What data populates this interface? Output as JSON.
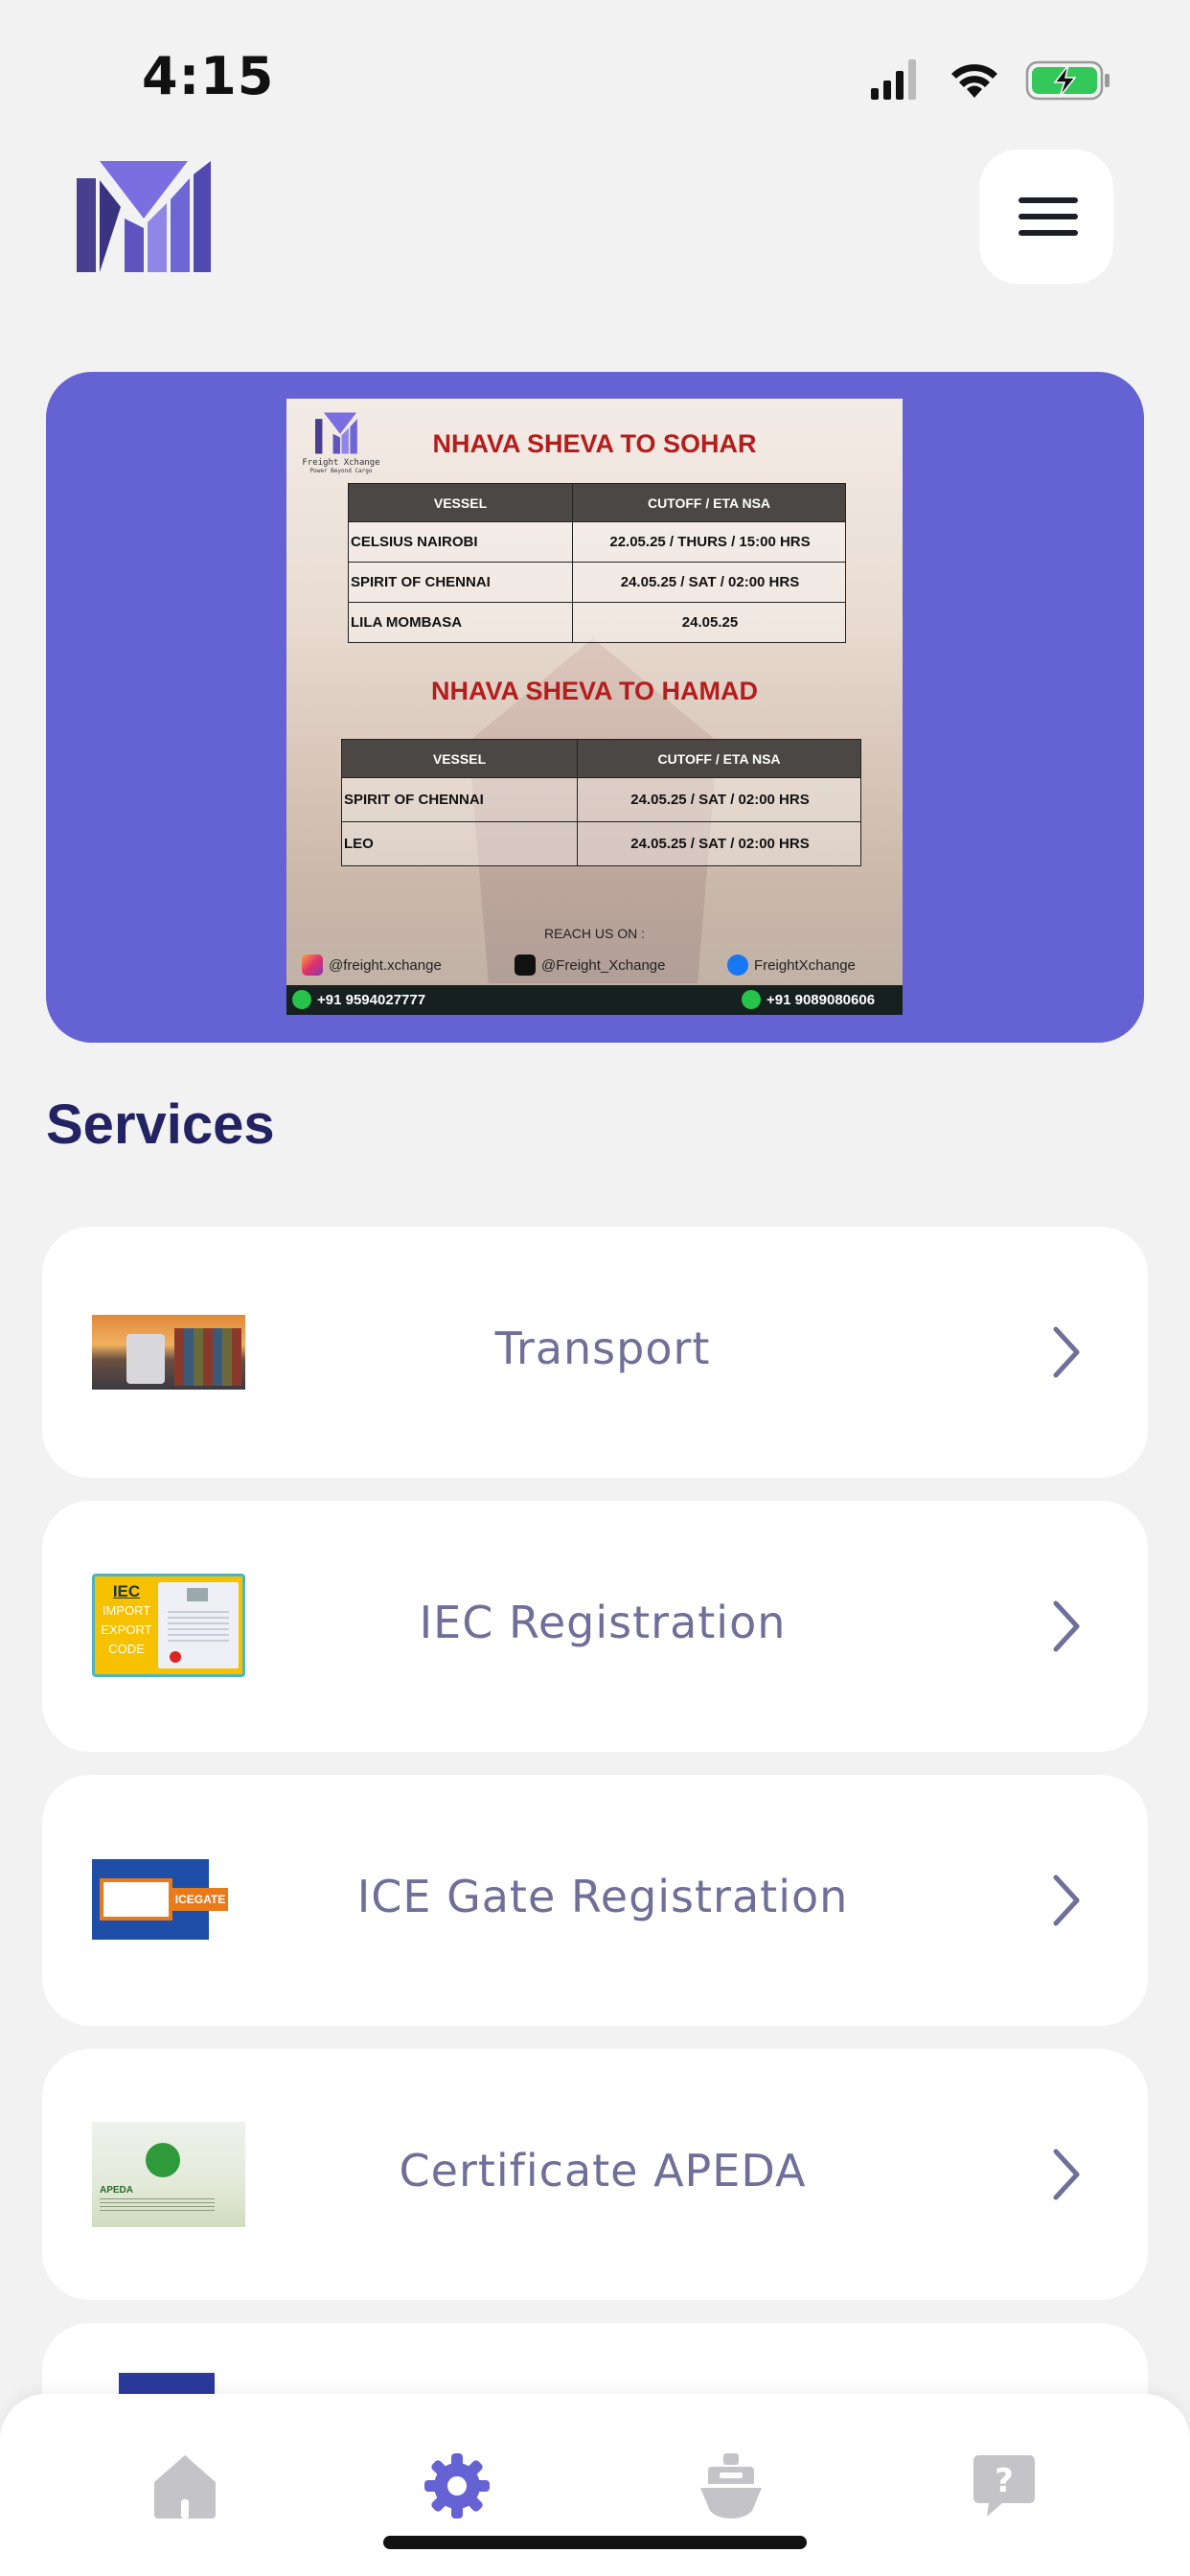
{
  "status_bar": {
    "time": "4:15"
  },
  "header": {
    "logo": "freight-xchange-logo",
    "menu_icon": "hamburger-icon"
  },
  "banner": {
    "brand": "Freight Xchange",
    "brand_tagline": "Power Beyond Cargo",
    "route1_title": "NHAVA SHEVA TO SOHAR",
    "route1_headers": [
      "VESSEL",
      "CUTOFF / ETA NSA"
    ],
    "route1_rows": [
      [
        "CELSIUS NAIROBI",
        "22.05.25 / THURS / 15:00 HRS"
      ],
      [
        "SPIRIT OF CHENNAI",
        "24.05.25 / SAT / 02:00 HRS"
      ],
      [
        "LILA MOMBASA",
        "24.05.25"
      ]
    ],
    "route2_title": "NHAVA SHEVA TO HAMAD",
    "route2_headers": [
      "VESSEL",
      "CUTOFF / ETA NSA"
    ],
    "route2_rows": [
      [
        "SPIRIT OF CHENNAI",
        "24.05.25 / SAT / 02:00 HRS"
      ],
      [
        "LEO",
        "24.05.25 / SAT / 02:00 HRS"
      ]
    ],
    "reach_us": "REACH US ON :",
    "instagram": "@freight.xchange",
    "x_handle": "@Freight_Xchange",
    "facebook": "FreightXchange",
    "phone1": "+91 9594027777",
    "phone2": "+91 9089080606"
  },
  "services": {
    "title": "Services",
    "items": [
      {
        "label": "Transport",
        "icon": "transport-thumbnail"
      },
      {
        "label": "IEC Registration",
        "icon": "iec-thumbnail"
      },
      {
        "label": "ICE Gate Registration",
        "icon": "icegate-thumbnail"
      },
      {
        "label": "Certificate APEDA",
        "icon": "apeda-thumbnail"
      }
    ],
    "thumb_text": {
      "iec_title": "IEC",
      "iec_lines": [
        "IMPORT",
        "EXPORT",
        "CODE"
      ],
      "icegate_badge": "ICEGATE",
      "apeda": "APEDA"
    }
  },
  "tabbar": {
    "tabs": [
      {
        "name": "home",
        "icon": "home-icon",
        "active": false
      },
      {
        "name": "services",
        "icon": "gear-icon",
        "active": true
      },
      {
        "name": "shipping",
        "icon": "ship-icon",
        "active": false
      },
      {
        "name": "help",
        "icon": "help-icon",
        "active": false
      }
    ],
    "active_color": "#6562d3",
    "inactive_color": "#c4c4c8"
  },
  "colors": {
    "accent": "#6562d3",
    "title": "#232263",
    "label": "#6f6f99",
    "background": "#f2f2f3"
  }
}
